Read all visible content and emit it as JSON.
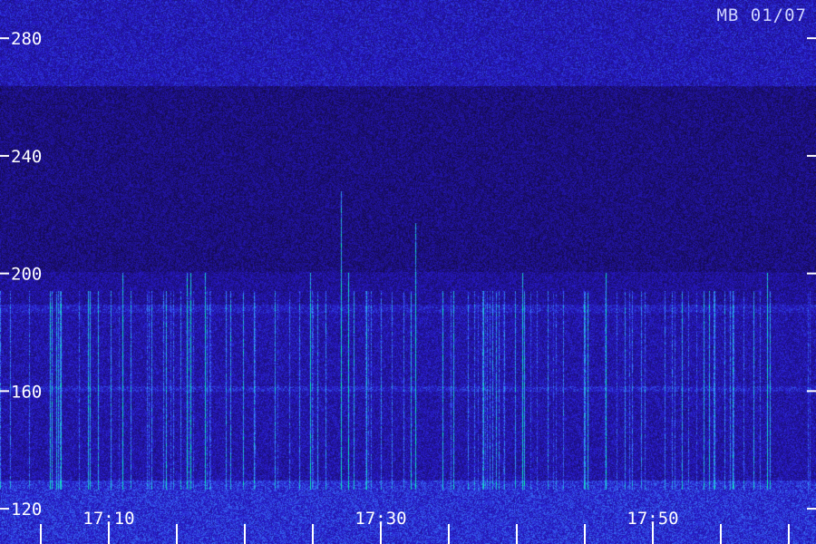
{
  "stamp": "MB 01/07",
  "chart_data": {
    "type": "heatmap",
    "title": "",
    "xlabel": "",
    "ylabel": "",
    "y_ticks": [
      280,
      240,
      200,
      160,
      120
    ],
    "ylim": [
      108,
      293
    ],
    "x_tick_labels": [
      "17:10",
      "17:30",
      "17:50"
    ],
    "x_label_minutes": [
      10,
      30,
      50
    ],
    "xlim_minutes": [
      2,
      62
    ],
    "minor_tick_interval_minutes": 5,
    "grid": false,
    "legend": "none",
    "colors": {
      "background": "#140a4a",
      "low": "#2418a8",
      "mid": "#3a7cff",
      "high": "#3cffb0",
      "labels": "#ffffff"
    }
  }
}
